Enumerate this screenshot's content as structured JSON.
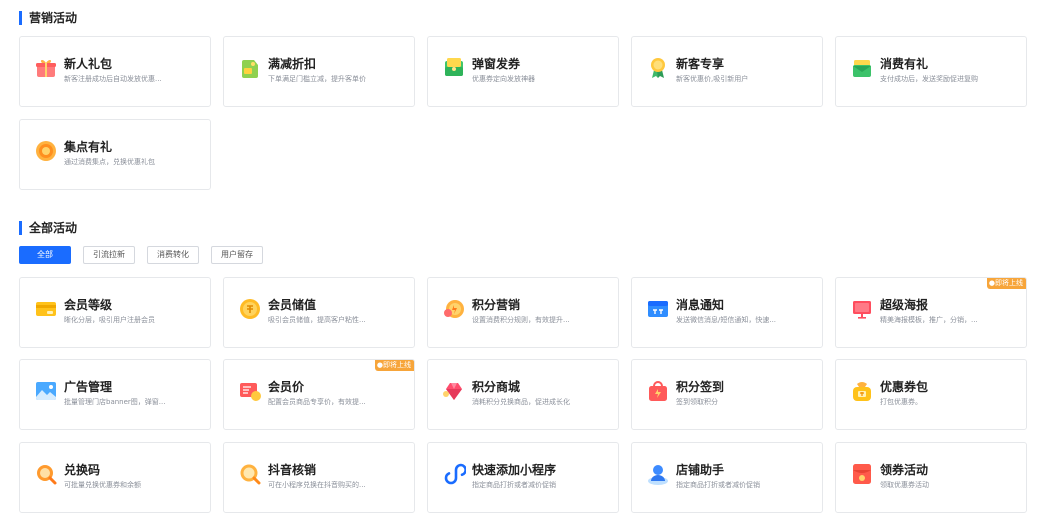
{
  "marketing": {
    "title": "营销活动",
    "cards": [
      {
        "title": "新人礼包",
        "desc": "新客注册成功后自动发放优惠...",
        "icon": "gift-icon"
      },
      {
        "title": "满减折扣",
        "desc": "下单满足门槛立减，提升客单价",
        "icon": "discount-tag-icon"
      },
      {
        "title": "弹窗发券",
        "desc": "优惠券定向发放神器",
        "icon": "popup-coupon-icon"
      },
      {
        "title": "新客专享",
        "desc": "新客优惠价,吸引新用户",
        "icon": "medal-icon"
      },
      {
        "title": "消费有礼",
        "desc": "支付成功后，发送奖励促进复购",
        "icon": "reward-envelope-icon"
      },
      {
        "title": "集点有礼",
        "desc": "通过消费集点，兑换优惠礼包",
        "icon": "points-coin-icon"
      }
    ]
  },
  "all": {
    "title": "全部活动",
    "tabs": [
      "全部",
      "引流拉新",
      "消费转化",
      "用户留存"
    ],
    "badge_label": "即将上线",
    "cards": [
      {
        "title": "会员等级",
        "desc": "晰化分层，吸引用户注册会员",
        "icon": "vip-card-icon",
        "badge": false
      },
      {
        "title": "会员储值",
        "desc": "吸引会员储值，提高客户粘性...",
        "icon": "coin-icon",
        "badge": false
      },
      {
        "title": "积分营销",
        "desc": "设置消费积分规则，有效提升...",
        "icon": "points-icon",
        "badge": false
      },
      {
        "title": "消息通知",
        "desc": "发送微信消息/短信通知，快速...",
        "icon": "message-icon",
        "badge": false
      },
      {
        "title": "超级海报",
        "desc": "精美海报模板，推广，分销，...",
        "icon": "poster-icon",
        "badge": true
      },
      {
        "title": "广告管理",
        "desc": "批量管理门店banner图，弹窗...",
        "icon": "ad-image-icon",
        "badge": false
      },
      {
        "title": "会员价",
        "desc": "配置会员商品专享价，有效提...",
        "icon": "member-price-icon",
        "badge": true
      },
      {
        "title": "积分商城",
        "desc": "消耗积分兑换商品，促进成长化",
        "icon": "gem-icon",
        "badge": false
      },
      {
        "title": "积分签到",
        "desc": "签到领取积分",
        "icon": "sign-in-bag-icon",
        "badge": false
      },
      {
        "title": "优惠券包",
        "desc": "打包优惠券。",
        "icon": "coupon-bag-icon",
        "badge": false
      },
      {
        "title": "兑换码",
        "desc": "可批量兑换优惠券和余额",
        "icon": "redeem-code-icon",
        "badge": false
      },
      {
        "title": "抖音核销",
        "desc": "可在小程序兑换在抖音购买的...",
        "icon": "douyin-verify-icon",
        "badge": false
      },
      {
        "title": "快速添加小程序",
        "desc": "指定商品打折或者减价促销",
        "icon": "mini-program-icon",
        "badge": false
      },
      {
        "title": "店铺助手",
        "desc": "指定商品打折或者减价促销",
        "icon": "assistant-icon",
        "badge": false
      },
      {
        "title": "领券活动",
        "desc": "领取优惠券活动",
        "icon": "red-envelope-icon",
        "badge": false
      }
    ]
  }
}
